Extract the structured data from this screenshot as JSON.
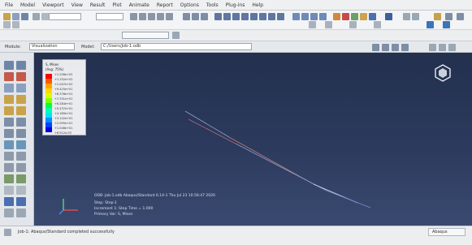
{
  "menu": [
    "File",
    "Model",
    "Viewport",
    "View",
    "Result",
    "Plot",
    "Animate",
    "Report",
    "Options",
    "Tools",
    "Plug-ins",
    "Help"
  ],
  "toolbar": {
    "module_label": "Module:",
    "module_value": "Visualization",
    "model_label": "Model:",
    "model_value": "C:/Users/Job-1.odb"
  },
  "viewport": {
    "legend": {
      "title1": "S, Mises",
      "title2": "(Avg: 75%)",
      "values": [
        "+1.256e+02",
        "+1.152e+02",
        "+1.047e+02",
        "+9.425e+01",
        "+8.378e+01",
        "+7.331e+01",
        "+6.284e+01",
        "+5.237e+01",
        "+4.189e+01",
        "+3.142e+01",
        "+2.095e+01",
        "+1.048e+01",
        "+6.912e-03"
      ],
      "colors": [
        "#ff0000",
        "#ff5a00",
        "#ffa500",
        "#ffd800",
        "#d8ff00",
        "#80ff00",
        "#00ff3c",
        "#00ffb0",
        "#00e0ff",
        "#0090ff",
        "#0040ff",
        "#0000e0"
      ]
    },
    "info_line1": "ODB: Job-1.odb   Abaqus/Standard 6.14-1   Thu Jul 23 10:56:47 2020",
    "info_line2": "Step: Step-1",
    "info_line3": "Increment 1: Step Time = 1.000",
    "info_line4": "Primary Var: S, Mises"
  },
  "status": {
    "message": "Job-1: Abaqus/Standard completed successfully",
    "tab_label": "Abaqus"
  }
}
